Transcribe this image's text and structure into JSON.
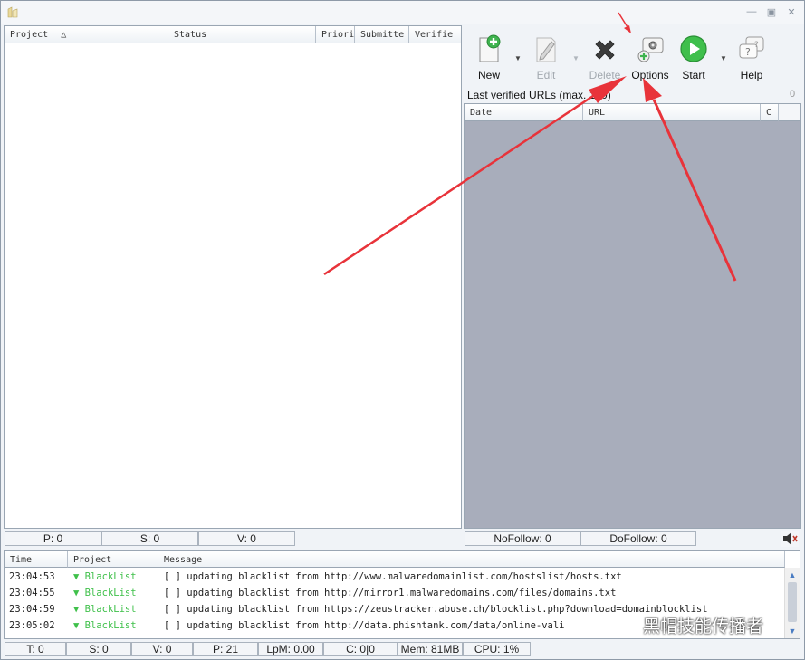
{
  "projects_table": {
    "columns": [
      "Project",
      "Status",
      "Priori",
      "Submitte",
      "Verifie"
    ]
  },
  "toolbar": {
    "new_label": "New",
    "edit_label": "Edit",
    "delete_label": "Delete",
    "options_label": "Options",
    "start_label": "Start",
    "help_label": "Help"
  },
  "verified": {
    "title": "Last verified URLs (max. 100)",
    "count": "0",
    "columns": [
      "Date",
      "URL",
      "C"
    ]
  },
  "project_status": {
    "p": "P: 0",
    "s": "S: 0",
    "v": "V: 0",
    "nofollow": "NoFollow:  0",
    "dofollow": "DoFollow: 0"
  },
  "log": {
    "columns": [
      "Time",
      "Project",
      "Message"
    ],
    "rows": [
      {
        "time": "23:04:53",
        "project": "BlackList",
        "message": "[ ] updating blacklist from http://www.malwaredomainlist.com/hostslist/hosts.txt"
      },
      {
        "time": "23:04:55",
        "project": "BlackList",
        "message": "[ ] updating blacklist from http://mirror1.malwaredomains.com/files/domains.txt"
      },
      {
        "time": "23:04:59",
        "project": "BlackList",
        "message": "[ ] updating blacklist from https://zeustracker.abuse.ch/blocklist.php?download=domainblocklist"
      },
      {
        "time": "23:05:02",
        "project": "BlackList",
        "message": "[ ] updating blacklist from http://data.phishtank.com/data/online-vali"
      }
    ]
  },
  "status_bar": {
    "t": "T: 0",
    "s": "S: 0",
    "v": "V: 0",
    "p": "P: 21",
    "lpm": "LpM: 0.00",
    "c": "C: 0|0",
    "mem": "Mem: 81MB",
    "cpu": "CPU: 1%"
  },
  "watermark": "黑帽技能传播者",
  "colors": {
    "annotation_arrow": "#e8333a",
    "verified_bg": "#a8adbb",
    "log_project": "#3fc04a"
  }
}
